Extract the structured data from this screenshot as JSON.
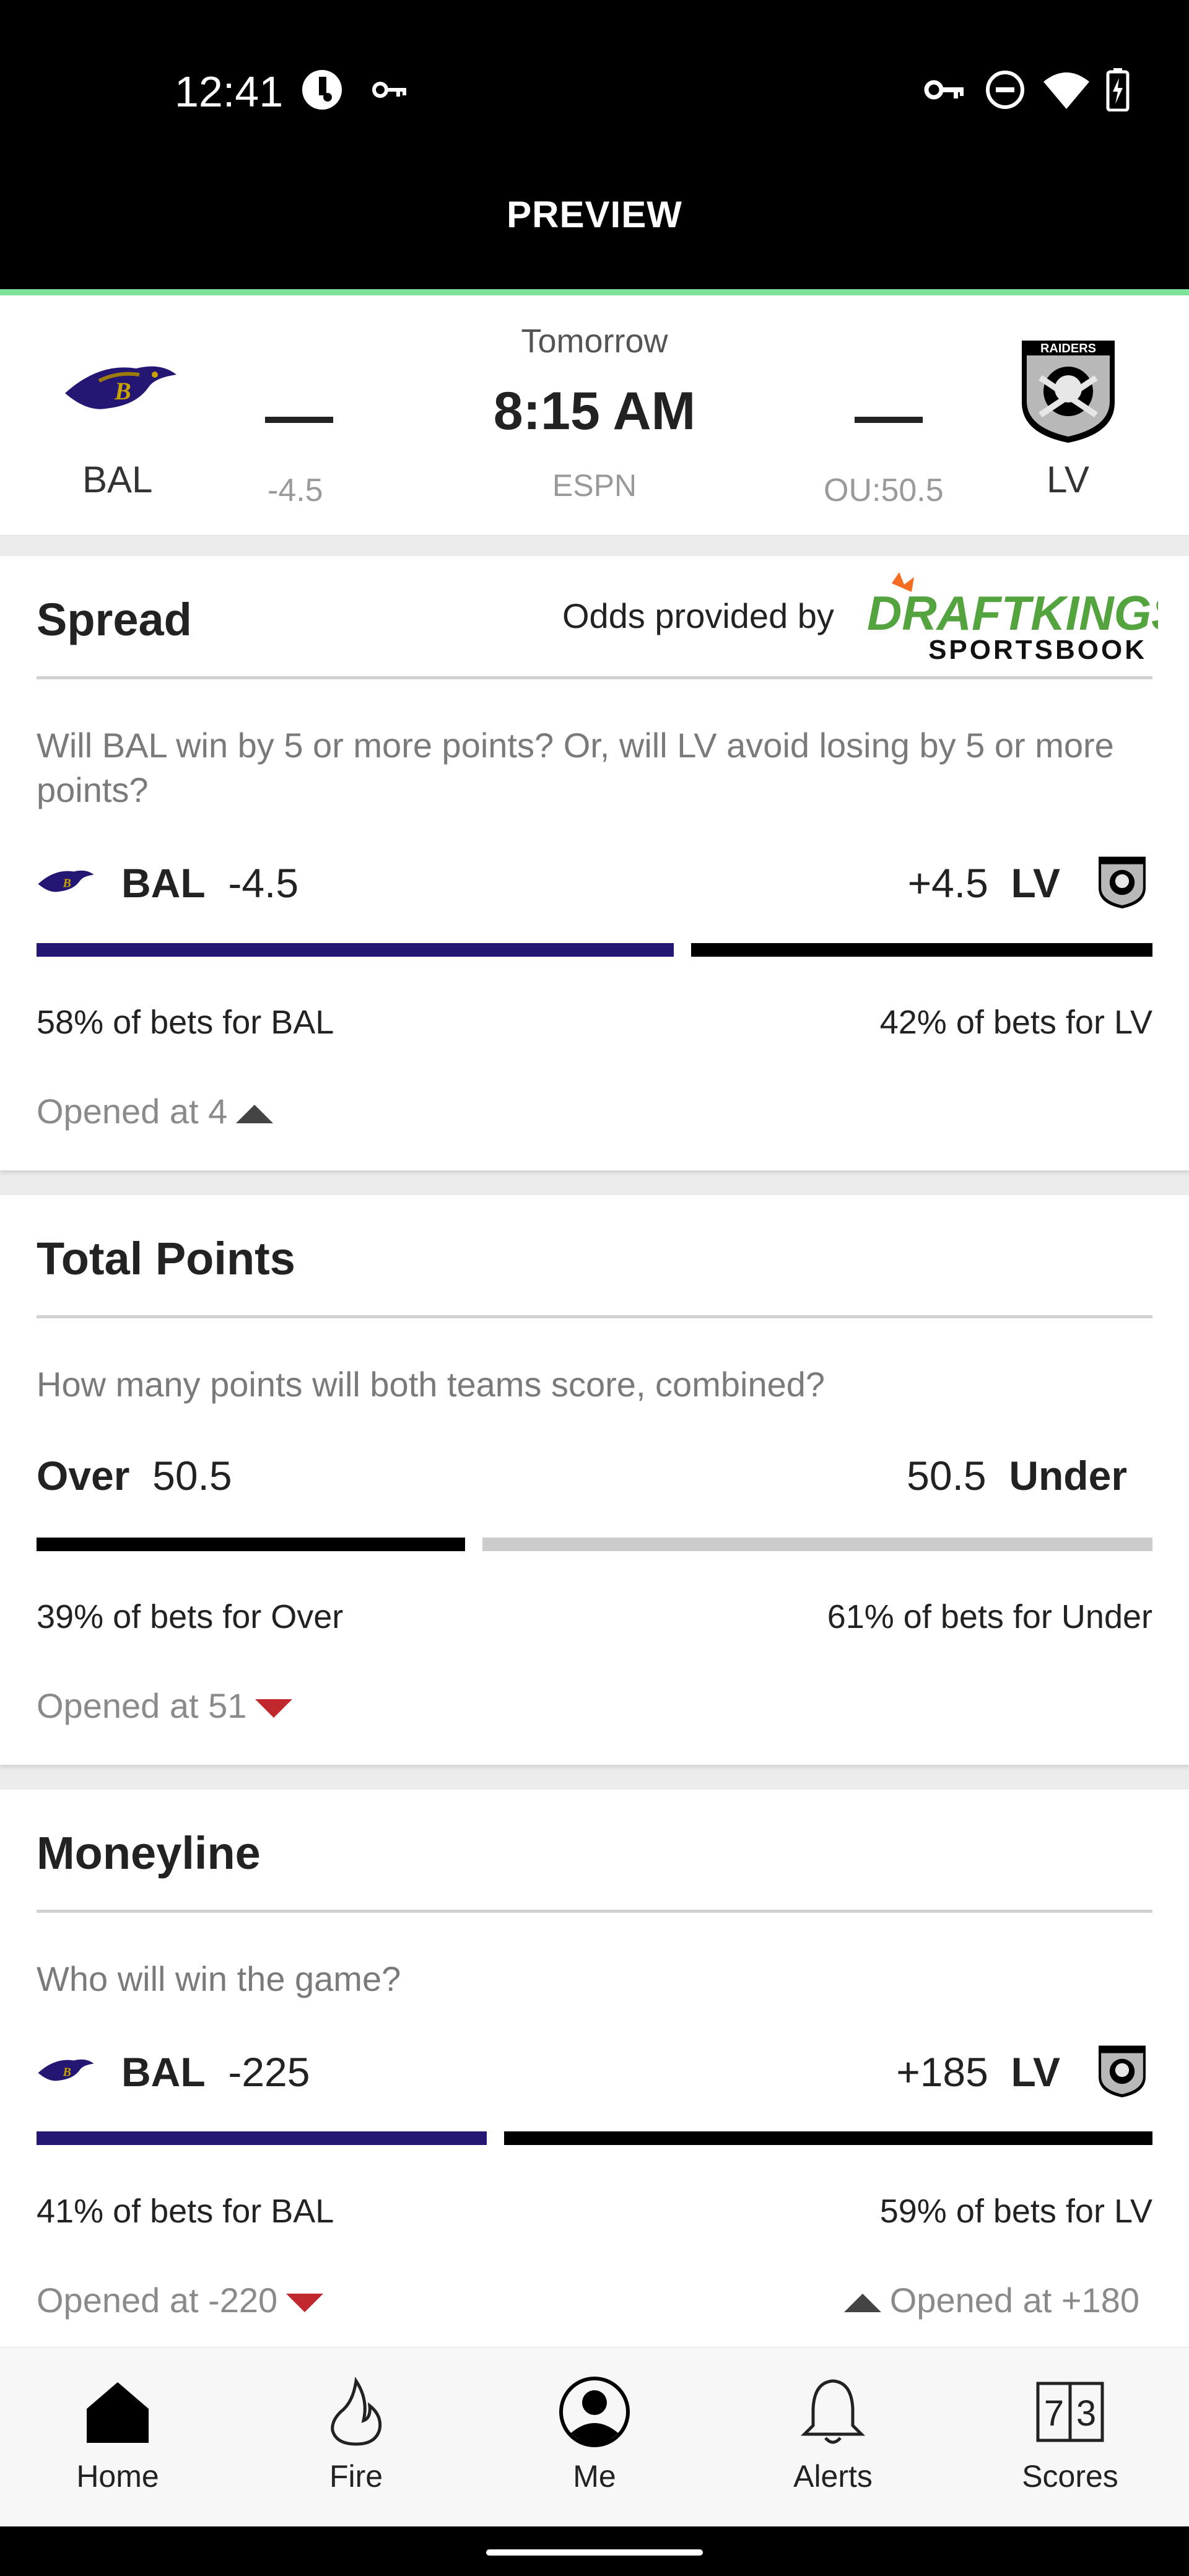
{
  "status_bar": {
    "time": "12:41"
  },
  "header": {
    "title": "PREVIEW"
  },
  "matchup": {
    "home": {
      "abbr": "BAL",
      "score": "—",
      "spread": "-4.5"
    },
    "away": {
      "abbr": "LV",
      "score": "—",
      "ou": "OU:50.5"
    },
    "date": "Tomorrow",
    "time": "8:15 AM",
    "network": "ESPN"
  },
  "spread": {
    "title": "Spread",
    "odds_provider_label": "Odds provided by",
    "provider_logo_primary": "DRAFTKINGS",
    "provider_logo_secondary": "SPORTSBOOK",
    "question": "Will BAL win by 5 or more points? Or, will LV avoid losing by 5 or more points?",
    "left_team": "BAL",
    "left_line": "-4.5",
    "right_team": "LV",
    "right_line": "+4.5",
    "left_pct_value": 58,
    "right_pct_value": 42,
    "left_pct_text": "58% of bets for BAL",
    "right_pct_text": "42% of bets for LV",
    "opened": "Opened at 4",
    "opened_direction": "up"
  },
  "total": {
    "title": "Total Points",
    "question": "How many points will both teams score, combined?",
    "left_label": "Over",
    "left_line": "50.5",
    "right_label": "Under",
    "right_line": "50.5",
    "left_pct_value": 39,
    "right_pct_value": 61,
    "left_pct_text": "39% of bets for Over",
    "right_pct_text": "61% of bets for Under",
    "opened": "Opened at 51",
    "opened_direction": "down"
  },
  "moneyline": {
    "title": "Moneyline",
    "question": "Who will win the game?",
    "left_team": "BAL",
    "left_line": "-225",
    "right_team": "LV",
    "right_line": "+185",
    "left_pct_value": 41,
    "right_pct_value": 59,
    "left_pct_text": "41% of bets for BAL",
    "right_pct_text": "59% of bets for LV",
    "opened_left": "Opened at -220",
    "opened_left_direction": "down",
    "opened_right": "Opened at +180",
    "opened_right_direction": "up"
  },
  "nav": [
    {
      "label": "Home",
      "icon": "home-icon"
    },
    {
      "label": "Fire",
      "icon": "fire-icon"
    },
    {
      "label": "Me",
      "icon": "profile-icon"
    },
    {
      "label": "Alerts",
      "icon": "bell-icon"
    },
    {
      "label": "Scores",
      "icon": "scores-icon"
    }
  ],
  "raiders_logo_text": "RAIDERS",
  "colors": {
    "ravens_purple": "#241773",
    "raiders_black": "#000000",
    "accent_green": "#7ee39a",
    "down_red": "#c0282d"
  }
}
